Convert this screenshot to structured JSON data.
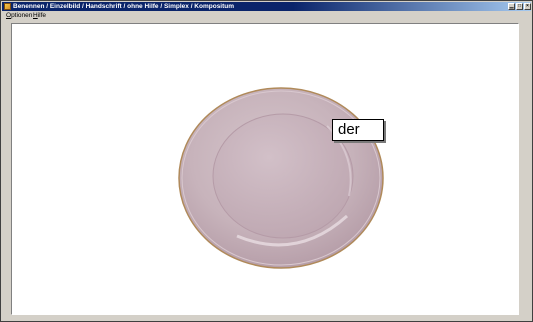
{
  "window": {
    "title": "Benennen / Einzelbild / Handschrift / ohne Hilfe / Simplex / Kompositum"
  },
  "menu": {
    "items": [
      {
        "label_rest": "ptionen",
        "accel": "O"
      },
      {
        "label_rest": "ilfe",
        "accel": "H"
      }
    ]
  },
  "main": {
    "image_subject": "plate-icon",
    "word": "der"
  },
  "colors": {
    "titlebar": "#0a246a",
    "plate": "#c9b4bd",
    "plate_rim": "#b08a5a"
  }
}
